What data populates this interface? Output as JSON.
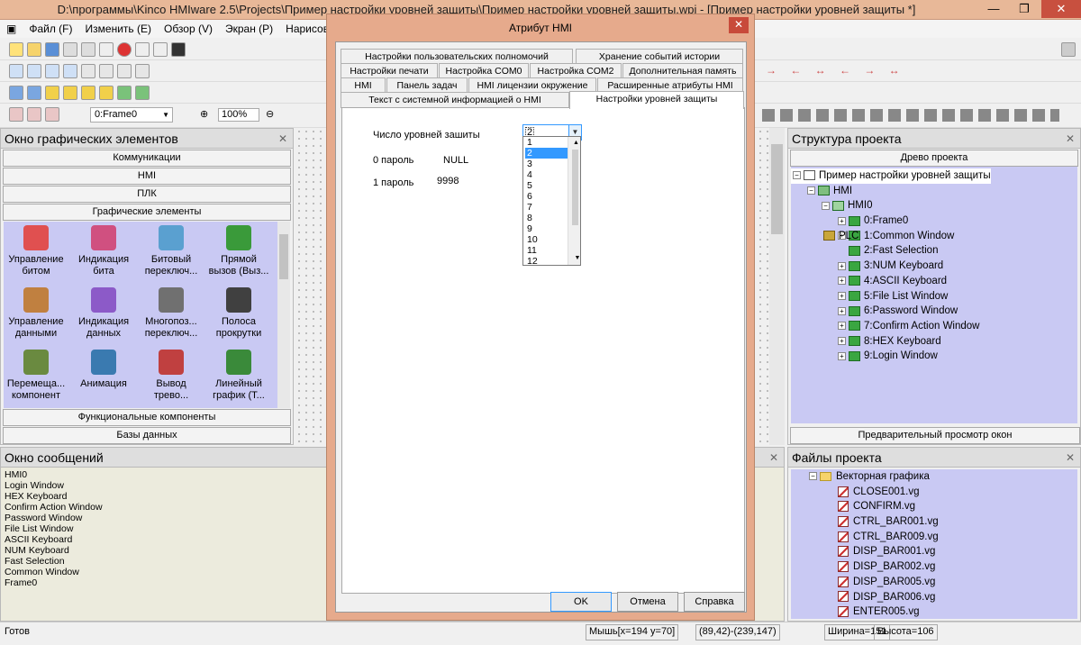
{
  "window": {
    "title": "D:\\программы\\Kinco HMIware 2.5\\Projects\\Пример настройки уровней защиты\\Пример настройки уровней защиты.wpj - [Пример настройки уровней защиты *]"
  },
  "menu": [
    "Файл (F)",
    "Изменить (E)",
    "Обзор (V)",
    "Экран (P)",
    "Нарисоват"
  ],
  "toolbar": {
    "frame_select": "0:Frame0",
    "zoom": "100%"
  },
  "left_panel": {
    "title": "Окно графических элементов",
    "categories_top": [
      "Коммуникации",
      "HMI",
      "ПЛК",
      "Графические элементы"
    ],
    "icons": [
      {
        "l1": "Управление",
        "l2": "битом",
        "icon": "bit-control-icon"
      },
      {
        "l1": "Индикация",
        "l2": "бита",
        "icon": "bit-indicator-icon"
      },
      {
        "l1": "Битовый",
        "l2": "переключ...",
        "icon": "bit-switch-icon"
      },
      {
        "l1": "Прямой",
        "l2": "вызов (Выз...",
        "icon": "direct-call-icon"
      },
      {
        "l1": "Управление",
        "l2": "данными",
        "icon": "data-control-icon"
      },
      {
        "l1": "Индикация",
        "l2": "данных",
        "icon": "data-indicator-icon"
      },
      {
        "l1": "Многопоз...",
        "l2": "переключ...",
        "icon": "multistate-switch-icon"
      },
      {
        "l1": "Полоса",
        "l2": "прокрутки",
        "icon": "scrollbar-icon"
      },
      {
        "l1": "Перемеща...",
        "l2": "компонент",
        "icon": "move-component-icon"
      },
      {
        "l1": "Анимация",
        "l2": "",
        "icon": "animation-icon"
      },
      {
        "l1": "Вывод",
        "l2": "трево...",
        "icon": "alarm-output-icon"
      },
      {
        "l1": "Линейный",
        "l2": "график (Т...",
        "icon": "line-chart-icon"
      }
    ],
    "categories_bottom": [
      "Функциональные компоненты",
      "Базы данных"
    ]
  },
  "messages": {
    "title": "Окно сообщений",
    "lines": [
      "HMI0",
      "Login Window",
      "HEX Keyboard",
      "Confirm Action Window",
      "Password Window",
      "File List Window",
      "ASCII Keyboard",
      "NUM Keyboard",
      "Fast Selection",
      "Common Window",
      "Frame0"
    ]
  },
  "project_tree": {
    "title": "Структура проекта",
    "tab": "Древо проекта",
    "root": "Пример настройки уровней защиты",
    "hmi": "HMI",
    "hmi0": "HMI0",
    "frames": [
      "0:Frame0",
      "1:Common Window",
      "2:Fast Selection",
      "3:NUM Keyboard",
      "4:ASCII Keyboard",
      "5:File List Window",
      "6:Password Window",
      "7:Confirm Action Window",
      "8:HEX Keyboard",
      "9:Login Window"
    ],
    "plc": "PLC",
    "preview_tab": "Предварительный просмотр окон"
  },
  "project_files": {
    "title": "Файлы проекта",
    "folder": "Векторная графика",
    "files": [
      "CLOSE001.vg",
      "CONFIRM.vg",
      "CTRL_BAR001.vg",
      "CTRL_BAR009.vg",
      "DISP_BAR001.vg",
      "DISP_BAR002.vg",
      "DISP_BAR005.vg",
      "DISP_BAR006.vg",
      "ENTER005.vg"
    ]
  },
  "status": {
    "ready": "Готов",
    "mouse": "Мышь[x=194  y=70]",
    "coords": "(89,42)-(239,147)",
    "width": "Ширина=151",
    "height": "Высота=106"
  },
  "dialog": {
    "title": "Атрибут HMI",
    "tabs_row1": [
      "Настройки пользовательских полномочий",
      "Хранение событий истории"
    ],
    "tabs_row2": [
      "Настройки печати",
      "Настройка COM0",
      "Настройка COM2",
      "Дополнительная память"
    ],
    "tabs_row3": [
      "HMI",
      "Панель задач",
      "HMI лицензии окружение",
      "Расширенные атрибуты HMI"
    ],
    "tabs_row4": [
      "Текст с системной информацией о HMI",
      "Настройки уровней защиты"
    ],
    "levels_label": "Число уровней зашиты",
    "levels_value": "2",
    "pw0_label": "0 пароль",
    "pw0_value": "NULL",
    "pw1_label": "1 пароль",
    "pw1_value": "9998",
    "dropdown_options": [
      "1",
      "2",
      "3",
      "4",
      "5",
      "6",
      "7",
      "8",
      "9",
      "10",
      "11",
      "12"
    ],
    "selected_option": "2",
    "ok": "OK",
    "cancel": "Отмена",
    "help": "Справка"
  }
}
